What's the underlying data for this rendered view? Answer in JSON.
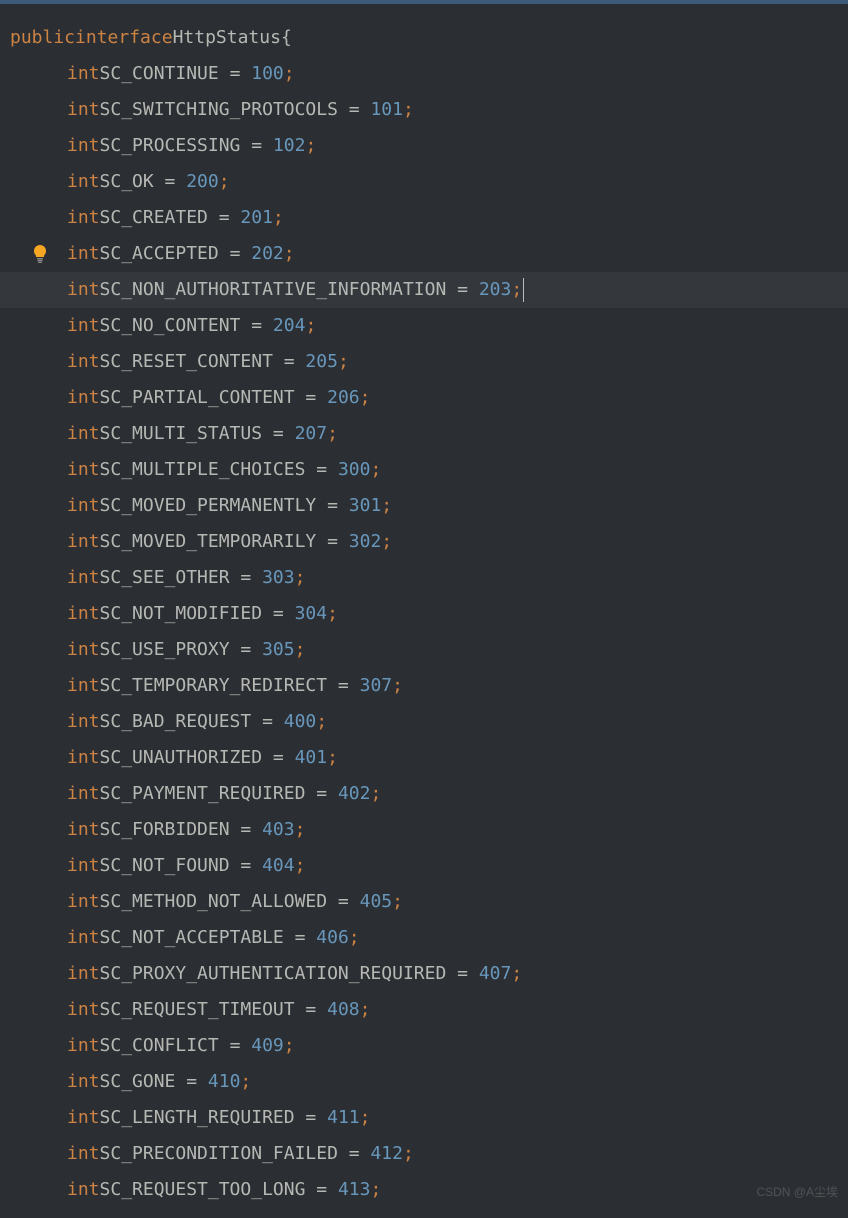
{
  "declaration": {
    "modifier_public": "public",
    "modifier_interface": "interface",
    "class_name": "HttpStatus",
    "open_brace": "{"
  },
  "fields": [
    {
      "type": "int",
      "name": "SC_CONTINUE",
      "value": "100"
    },
    {
      "type": "int",
      "name": "SC_SWITCHING_PROTOCOLS",
      "value": "101"
    },
    {
      "type": "int",
      "name": "SC_PROCESSING",
      "value": "102"
    },
    {
      "type": "int",
      "name": "SC_OK",
      "value": "200"
    },
    {
      "type": "int",
      "name": "SC_CREATED",
      "value": "201"
    },
    {
      "type": "int",
      "name": "SC_ACCEPTED",
      "value": "202",
      "bulb": true
    },
    {
      "type": "int",
      "name": "SC_NON_AUTHORITATIVE_INFORMATION",
      "value": "203",
      "highlighted": true,
      "cursor": true
    },
    {
      "type": "int",
      "name": "SC_NO_CONTENT",
      "value": "204"
    },
    {
      "type": "int",
      "name": "SC_RESET_CONTENT",
      "value": "205"
    },
    {
      "type": "int",
      "name": "SC_PARTIAL_CONTENT",
      "value": "206"
    },
    {
      "type": "int",
      "name": "SC_MULTI_STATUS",
      "value": "207"
    },
    {
      "type": "int",
      "name": "SC_MULTIPLE_CHOICES",
      "value": "300"
    },
    {
      "type": "int",
      "name": "SC_MOVED_PERMANENTLY",
      "value": "301"
    },
    {
      "type": "int",
      "name": "SC_MOVED_TEMPORARILY",
      "value": "302"
    },
    {
      "type": "int",
      "name": "SC_SEE_OTHER",
      "value": "303"
    },
    {
      "type": "int",
      "name": "SC_NOT_MODIFIED",
      "value": "304"
    },
    {
      "type": "int",
      "name": "SC_USE_PROXY",
      "value": "305"
    },
    {
      "type": "int",
      "name": "SC_TEMPORARY_REDIRECT",
      "value": "307"
    },
    {
      "type": "int",
      "name": "SC_BAD_REQUEST",
      "value": "400"
    },
    {
      "type": "int",
      "name": "SC_UNAUTHORIZED",
      "value": "401"
    },
    {
      "type": "int",
      "name": "SC_PAYMENT_REQUIRED",
      "value": "402"
    },
    {
      "type": "int",
      "name": "SC_FORBIDDEN",
      "value": "403"
    },
    {
      "type": "int",
      "name": "SC_NOT_FOUND",
      "value": "404"
    },
    {
      "type": "int",
      "name": "SC_METHOD_NOT_ALLOWED",
      "value": "405"
    },
    {
      "type": "int",
      "name": "SC_NOT_ACCEPTABLE",
      "value": "406"
    },
    {
      "type": "int",
      "name": "SC_PROXY_AUTHENTICATION_REQUIRED",
      "value": "407"
    },
    {
      "type": "int",
      "name": "SC_REQUEST_TIMEOUT",
      "value": "408"
    },
    {
      "type": "int",
      "name": "SC_CONFLICT",
      "value": "409"
    },
    {
      "type": "int",
      "name": "SC_GONE",
      "value": "410"
    },
    {
      "type": "int",
      "name": "SC_LENGTH_REQUIRED",
      "value": "411"
    },
    {
      "type": "int",
      "name": "SC_PRECONDITION_FAILED",
      "value": "412"
    },
    {
      "type": "int",
      "name": "SC_REQUEST_TOO_LONG",
      "value": "413"
    }
  ],
  "watermark": "CSDN @A尘埃"
}
